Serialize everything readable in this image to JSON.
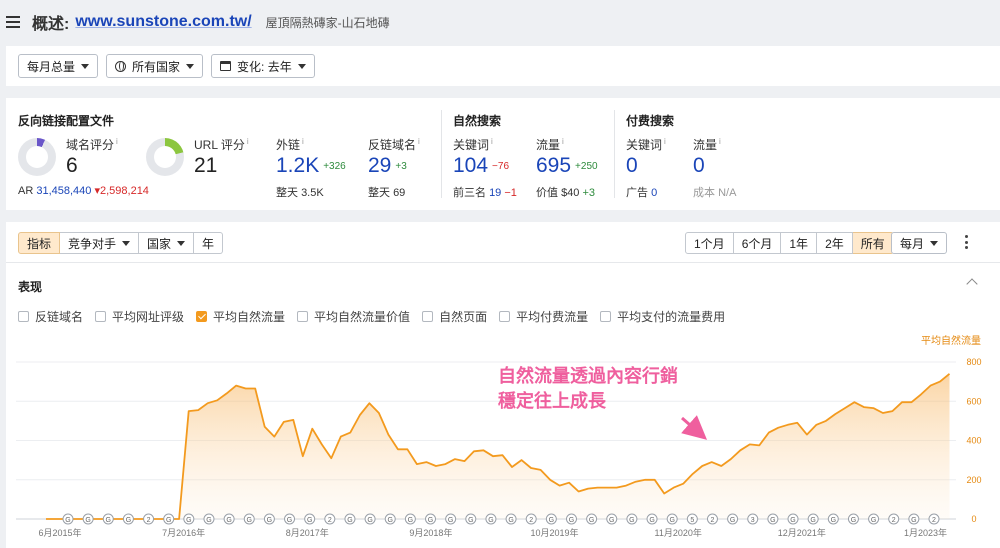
{
  "header": {
    "label": "概述:",
    "url": "www.sunstone.com.tw/",
    "subtitle": "屋頂隔熱磚家-山石地磚"
  },
  "filters": {
    "monthly_total": "每月总量",
    "all_countries": "所有国家",
    "change": "变化: 去年"
  },
  "backlinks": {
    "title": "反向链接配置文件",
    "dr_label": "域名评分",
    "dr_value": "6",
    "ur_label": "URL 评分",
    "ur_value": "21",
    "ar_label": "AR",
    "ar_value": "31,458,440",
    "ar_delta": "▾2,598,214",
    "ext_label": "外链",
    "ext_value": "1.2K",
    "ext_delta": "+326",
    "ext_sub_label": "整天",
    "ext_sub_value": "3.5K",
    "rd_label": "反链域名",
    "rd_value": "29",
    "rd_delta": "+3",
    "rd_sub_label": "整天",
    "rd_sub_value": "69",
    "info_mark": "i"
  },
  "organic": {
    "title": "自然搜索",
    "kw_label": "关键词",
    "kw_value": "104",
    "kw_delta": "−76",
    "top3_label": "前三名",
    "top3_value": "19",
    "top3_delta": "−1",
    "traffic_label": "流量",
    "traffic_value": "695",
    "traffic_delta": "+250",
    "value_label": "价值",
    "value_value": "$40",
    "value_delta": "+3"
  },
  "paid": {
    "title": "付费搜索",
    "kw_label": "关键词",
    "kw_value": "0",
    "ads_label": "广告",
    "ads_value": "0",
    "traffic_label": "流量",
    "traffic_value": "0",
    "cost_label": "成本",
    "cost_value": "N/A"
  },
  "tabs": {
    "metrics": "指标",
    "competitors": "竞争对手",
    "countries": "国家",
    "years": "年",
    "r1m": "1个月",
    "r6m": "6个月",
    "r1y": "1年",
    "r2y": "2年",
    "rall": "所有",
    "monthly": "每月"
  },
  "performance": {
    "title": "表现",
    "checks": [
      "反链域名",
      "平均网址评级",
      "平均自然流量",
      "平均自然流量价值",
      "自然页面",
      "平均付费流量",
      "平均支付的流量费用"
    ],
    "checked_index": 2
  },
  "chart_data": {
    "type": "area",
    "series": [
      {
        "name": "平均自然流量",
        "color": "#f39a1e"
      }
    ],
    "y_label": "平均自然流量",
    "ylim": [
      0,
      800
    ],
    "y_ticks": [
      "0",
      "200",
      "400",
      "600",
      "800"
    ],
    "x_ticks": [
      "6月2015年",
      "7月2016年",
      "8月2017年",
      "9月2018年",
      "10月2019年",
      "11月2020年",
      "12月2021年",
      "1月2023年"
    ],
    "x_start_month": 0,
    "x_end_month": 94,
    "x_tick_months": [
      0,
      13,
      26,
      39,
      52,
      65,
      78,
      91
    ],
    "points": [
      [
        0,
        0
      ],
      [
        8,
        0
      ],
      [
        13,
        0
      ],
      [
        14,
        0
      ],
      [
        15,
        550
      ],
      [
        16,
        555
      ],
      [
        17,
        590
      ],
      [
        18,
        605
      ],
      [
        19,
        640
      ],
      [
        20,
        680
      ],
      [
        21,
        665
      ],
      [
        22,
        665
      ],
      [
        23,
        470
      ],
      [
        24,
        420
      ],
      [
        25,
        495
      ],
      [
        26,
        505
      ],
      [
        27,
        320
      ],
      [
        28,
        460
      ],
      [
        29,
        380
      ],
      [
        30,
        310
      ],
      [
        31,
        420
      ],
      [
        32,
        440
      ],
      [
        33,
        530
      ],
      [
        34,
        590
      ],
      [
        35,
        540
      ],
      [
        36,
        430
      ],
      [
        37,
        355
      ],
      [
        38,
        355
      ],
      [
        39,
        280
      ],
      [
        40,
        290
      ],
      [
        41,
        270
      ],
      [
        42,
        280
      ],
      [
        43,
        305
      ],
      [
        44,
        295
      ],
      [
        45,
        345
      ],
      [
        46,
        350
      ],
      [
        47,
        320
      ],
      [
        48,
        325
      ],
      [
        49,
        265
      ],
      [
        50,
        300
      ],
      [
        51,
        260
      ],
      [
        52,
        250
      ],
      [
        53,
        200
      ],
      [
        54,
        170
      ],
      [
        55,
        185
      ],
      [
        56,
        140
      ],
      [
        57,
        155
      ],
      [
        58,
        160
      ],
      [
        59,
        160
      ],
      [
        60,
        160
      ],
      [
        61,
        170
      ],
      [
        62,
        190
      ],
      [
        63,
        200
      ],
      [
        64,
        200
      ],
      [
        65,
        130
      ],
      [
        66,
        160
      ],
      [
        67,
        180
      ],
      [
        68,
        230
      ],
      [
        69,
        270
      ],
      [
        70,
        290
      ],
      [
        71,
        270
      ],
      [
        72,
        305
      ],
      [
        73,
        350
      ],
      [
        74,
        380
      ],
      [
        75,
        375
      ],
      [
        76,
        440
      ],
      [
        77,
        465
      ],
      [
        78,
        480
      ],
      [
        79,
        490
      ],
      [
        80,
        430
      ],
      [
        81,
        480
      ],
      [
        82,
        500
      ],
      [
        83,
        535
      ],
      [
        84,
        565
      ],
      [
        85,
        595
      ],
      [
        86,
        570
      ],
      [
        87,
        565
      ],
      [
        88,
        540
      ],
      [
        89,
        550
      ],
      [
        90,
        595
      ],
      [
        91,
        595
      ],
      [
        92,
        635
      ],
      [
        93,
        680
      ],
      [
        94,
        700
      ],
      [
        95,
        740
      ]
    ],
    "annotations_text": [
      "G",
      "G",
      "G",
      "G",
      "2",
      "G",
      "G",
      "G",
      "G",
      "G",
      "G",
      "G",
      "G",
      "2",
      "G",
      "G",
      "G",
      "G",
      "G",
      "G",
      "G",
      "G",
      "G",
      "2",
      "G",
      "G",
      "G",
      "G",
      "G",
      "G",
      "G",
      "5",
      "2",
      "G",
      "3",
      "G",
      "G",
      "G",
      "G",
      "G",
      "G",
      "2",
      "G",
      "2"
    ],
    "callout": {
      "line1": "自然流量透過內容行銷",
      "line2": "穩定往上成長",
      "color": "#ef5f9e"
    },
    "grid": true
  }
}
